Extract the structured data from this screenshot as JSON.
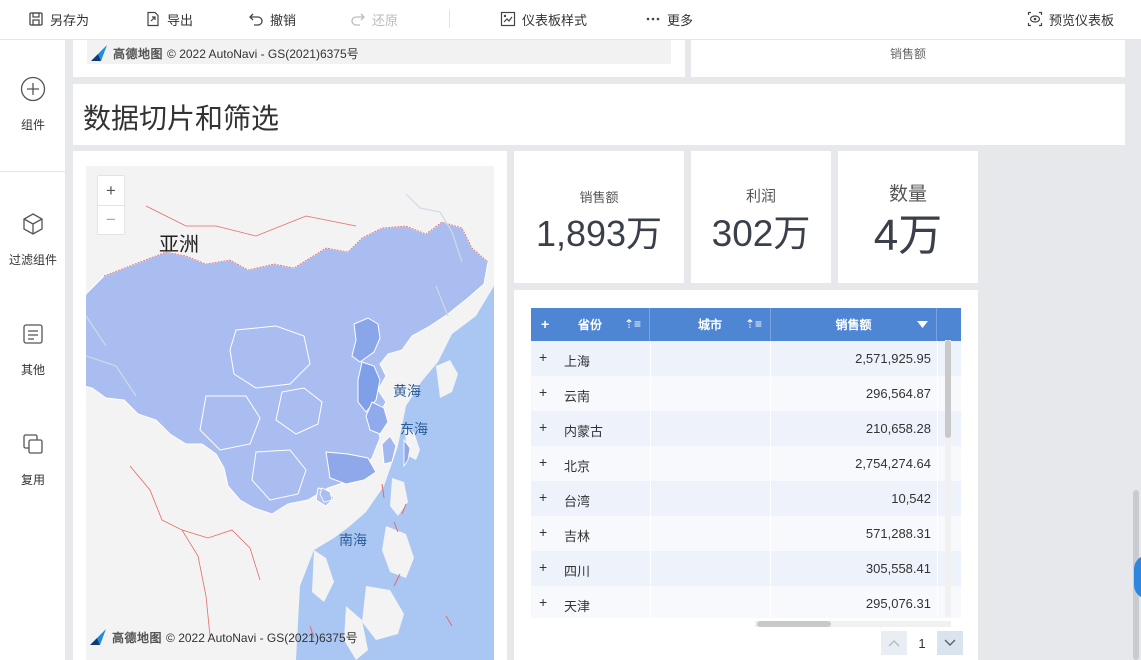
{
  "toolbar": {
    "save_as": "另存为",
    "export": "导出",
    "undo": "撤销",
    "redo": "还原",
    "style": "仪表板样式",
    "more": "更多",
    "preview": "预览仪表板"
  },
  "rail": {
    "components": "组件",
    "filter_components": "过滤组件",
    "other": "其他",
    "reuse": "复用"
  },
  "top_cards": {
    "map_attribution_brand": "高德地图",
    "map_attribution": "© 2022 AutoNavi - GS(2021)6375号",
    "chart_axis_title": "销售额"
  },
  "section": {
    "title": "数据切片和筛选"
  },
  "map": {
    "zoom_in": "+",
    "zoom_out": "−",
    "labels": {
      "asia": "亚洲",
      "yellow_sea": "黄海",
      "east_sea": "东海",
      "south_sea": "南海"
    },
    "attribution_brand": "高德地图",
    "attribution": "© 2022 AutoNavi - GS(2021)6375号",
    "colors": {
      "water": "#a9c7f2",
      "land": "#f3f3f3",
      "region": "#aabdf0",
      "region_dark": "#7f9fe8",
      "border": "#e36b6b"
    }
  },
  "kpis": [
    {
      "label": "销售额",
      "value": "1,893万"
    },
    {
      "label": "利润",
      "value": "302万"
    },
    {
      "label": "数量",
      "value": "4万"
    }
  ],
  "table": {
    "columns": [
      "省份",
      "城市",
      "销售额"
    ],
    "header_plus": "+",
    "rows": [
      {
        "province": "上海",
        "sales": "2,571,925.95"
      },
      {
        "province": "云南",
        "sales": "296,564.87"
      },
      {
        "province": "内蒙古",
        "sales": "210,658.28"
      },
      {
        "province": "北京",
        "sales": "2,754,274.64"
      },
      {
        "province": "台湾",
        "sales": "10,542"
      },
      {
        "province": "吉林",
        "sales": "571,288.31"
      },
      {
        "province": "四川",
        "sales": "305,558.41"
      },
      {
        "province": "天津",
        "sales": "295,076.31"
      }
    ],
    "header_color": "#4f86d3"
  },
  "pagination": {
    "page": "1"
  }
}
